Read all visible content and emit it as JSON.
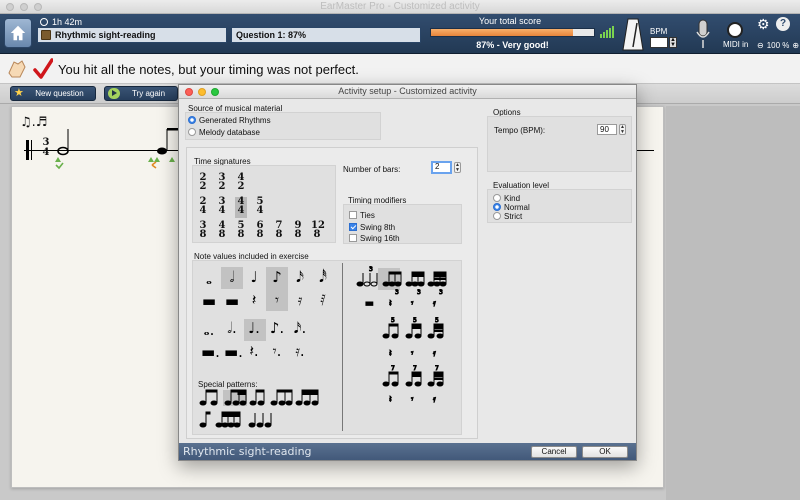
{
  "window": {
    "title": "EarMaster Pro - Customized activity"
  },
  "topbar": {
    "elapsed_time": "1h 42m",
    "exercise_name": "Rhythmic sight-reading",
    "question": "Question 1: 87%",
    "score_title": "Your total score",
    "score_progress": 0.87,
    "score_text": "87% - Very good!",
    "bpm_label": "BPM",
    "midi_label": "MIDI in",
    "zoom": "100 %"
  },
  "feedback": {
    "message": "You hit all the notes, but your timing was not perfect."
  },
  "toolbar": {
    "new_question_label": "New question",
    "try_again_label": "Try again"
  },
  "score": {
    "time_signature_top": "3",
    "time_signature_bottom": "4",
    "rhythm_hint": "♫.♬"
  },
  "dialog": {
    "title": "Activity setup - Customized activity",
    "source_heading": "Source of musical material",
    "source_options": [
      "Generated Rhythms",
      "Melody database"
    ],
    "source_selected": 0,
    "time_sig_heading": "Time signatures",
    "time_signatures": {
      "row1": [
        [
          "2",
          "2"
        ],
        [
          "3",
          "2"
        ],
        [
          "4",
          "2"
        ]
      ],
      "row2": [
        [
          "2",
          "4"
        ],
        [
          "3",
          "4"
        ],
        [
          "4",
          "4"
        ],
        [
          "5",
          "4"
        ]
      ],
      "row3": [
        [
          "3",
          "8"
        ],
        [
          "4",
          "8"
        ],
        [
          "5",
          "8"
        ],
        [
          "6",
          "8"
        ],
        [
          "7",
          "8"
        ],
        [
          "9",
          "8"
        ],
        [
          "12",
          "8"
        ]
      ]
    },
    "bars_label": "Number of bars:",
    "bars_value": "2",
    "timing_heading": "Timing modifiers",
    "timing_options": [
      {
        "label": "Ties",
        "checked": false
      },
      {
        "label": "Swing 8th",
        "checked": true
      },
      {
        "label": "Swing 16th",
        "checked": false
      }
    ],
    "note_values_heading": "Note values included in exercise",
    "special_heading": "Special patterns:",
    "options_heading": "Options",
    "tempo_label": "Tempo (BPM):",
    "tempo_value": "90",
    "eval_heading": "Evaluation level",
    "eval_options": [
      "Kind",
      "Normal",
      "Strict"
    ],
    "eval_selected": 1,
    "footer_title": "Rhythmic sight-reading",
    "cancel_label": "Cancel",
    "ok_label": "OK"
  },
  "colors": {
    "toolbar_blue": "#2a4262",
    "score_orange": "#ee8e42",
    "success_red": "#d0161b",
    "selection_blue": "#3a83e8"
  }
}
